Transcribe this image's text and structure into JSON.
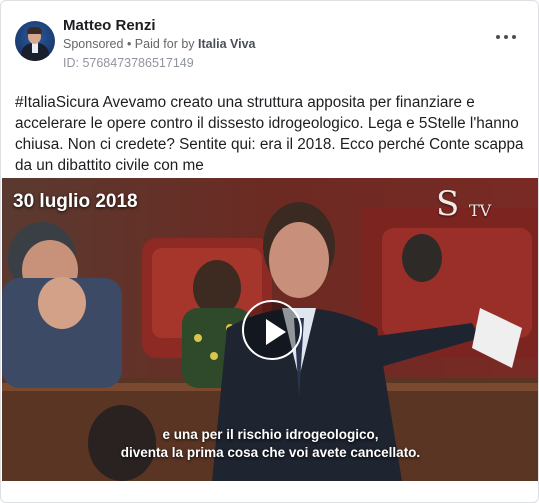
{
  "post": {
    "page_name": "Matteo Renzi",
    "sponsored_label": "Sponsored",
    "separator": " • ",
    "paid_prefix": "Paid for by ",
    "payer": "Italia Viva",
    "ad_id": "ID: 5768473786517149",
    "text": "#ItaliaSicura Avevamo creato una struttura apposita per finanziare e accelerare le opere contro il dissesto idrogeologico. Lega e 5Stelle l'hanno chiusa. Non ci credete? Sentite qui: era il 2018. Ecco perché Conte scappa da un dibattito civile con me"
  },
  "video": {
    "date_overlay": "30 luglio 2018",
    "logo_letter": "S",
    "logo_tv": "TV",
    "subtitle_line1": "e una per il rischio idrogeologico,",
    "subtitle_line2": "diventa la prima cosa che voi avete cancellato.",
    "play_icon": "play-icon"
  },
  "icons": {
    "more": "more-options-icon",
    "avatar": "profile-avatar"
  },
  "colors": {
    "name": "#1c1e21",
    "meta": "#65676b",
    "adid": "#90949c",
    "border": "#dddfe2"
  }
}
